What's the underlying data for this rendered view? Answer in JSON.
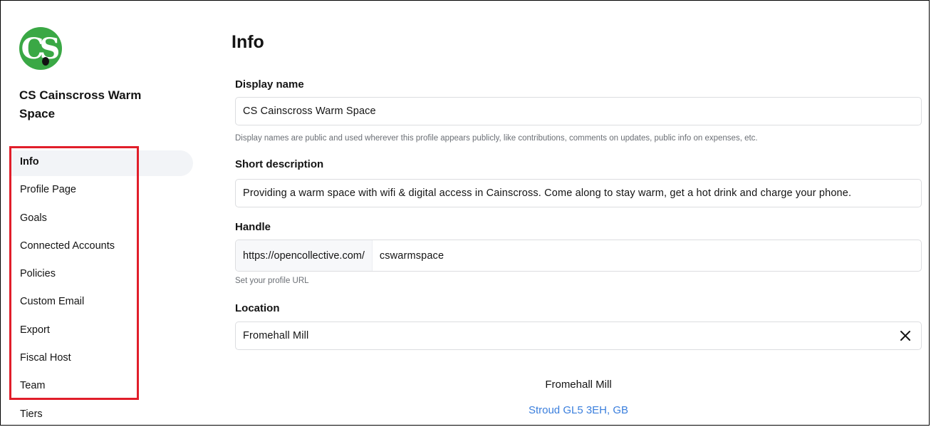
{
  "sidebar": {
    "avatar_text": "CS",
    "org_name": "CS Cainscross Warm Space",
    "items": [
      {
        "label": "Info"
      },
      {
        "label": "Profile Page"
      },
      {
        "label": "Goals"
      },
      {
        "label": "Connected Accounts"
      },
      {
        "label": "Policies"
      },
      {
        "label": "Custom Email"
      },
      {
        "label": "Export"
      },
      {
        "label": "Fiscal Host"
      },
      {
        "label": "Team"
      },
      {
        "label": "Tiers"
      }
    ],
    "active_item": "Info"
  },
  "main": {
    "title": "Info",
    "display_name": {
      "label": "Display name",
      "value": "CS Cainscross Warm Space",
      "help": "Display names are public and used wherever this profile appears publicly, like contributions, comments on updates, public info on expenses, etc."
    },
    "short_description": {
      "label": "Short description",
      "value": "Providing a warm space with wifi & digital access in Cainscross. Come along to stay warm, get a hot drink and charge your phone."
    },
    "handle": {
      "label": "Handle",
      "prefix": "https://opencollective.com/",
      "value": "cswarmspace",
      "help": "Set your profile URL"
    },
    "location": {
      "label": "Location",
      "value": "Fromehall Mill",
      "place_name": "Fromehall Mill",
      "address": "Stroud GL5 3EH, GB"
    }
  },
  "colors": {
    "avatar_bg": "#3aa845",
    "annotation_box": "#e11e2a",
    "link": "#3b7fdd",
    "active_bg": "#f2f4f7"
  },
  "icons": {
    "clear": "close-icon"
  }
}
